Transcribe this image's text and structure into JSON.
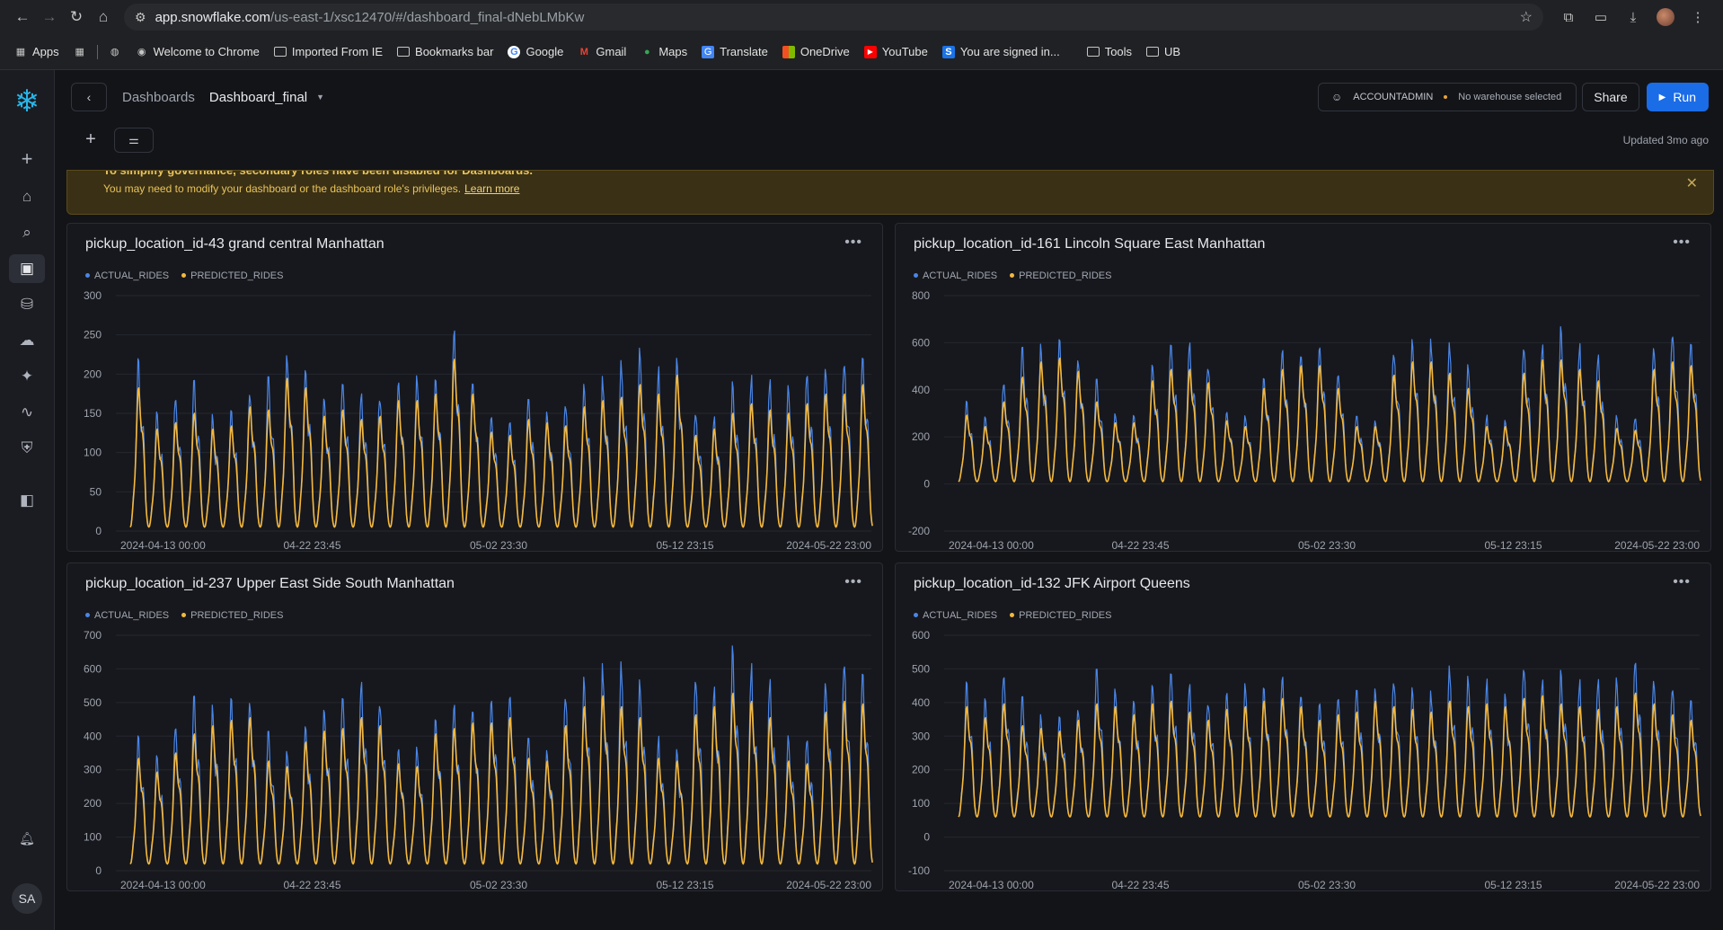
{
  "browser": {
    "url_host": "app.snowflake.com",
    "url_path": "/us-east-1/xsc12470/#/dashboard_final-dNebLMbKw",
    "bookmarks": [
      "Apps",
      "Welcome to Chrome",
      "Imported From IE",
      "Bookmarks bar",
      "Google",
      "Gmail",
      "Maps",
      "Translate",
      "OneDrive",
      "YouTube",
      "You are signed in...",
      "Tools",
      "UB"
    ]
  },
  "header": {
    "breadcrumb": "Dashboards",
    "dashboard_name": "Dashboard_final",
    "role": "ACCOUNTADMIN",
    "warehouse": "No warehouse selected",
    "share_label": "Share",
    "run_label": "Run",
    "updated": "Updated 3mo ago"
  },
  "banner": {
    "title": "To simplify governance, secondary roles have been disabled for Dashboards.",
    "message": "You may need to modify your dashboard or the dashboard role's privileges.",
    "link": "Learn more"
  },
  "user_initials": "SA",
  "legend": {
    "actual": "ACTUAL_RIDES",
    "predicted": "PREDICTED_RIDES"
  },
  "colors": {
    "actual": "#4a86e8",
    "predicted": "#f5b83d",
    "accent": "#1a6ce7"
  },
  "chart_data": [
    {
      "type": "line",
      "title": "pickup_location_id-43 grand central Manhattan",
      "series": [
        {
          "name": "ACTUAL_RIDES"
        },
        {
          "name": "PREDICTED_RIDES"
        }
      ],
      "x_ticks": [
        "2024-04-13 00:00",
        "04-22 23:45",
        "05-02 23:30",
        "05-12 23:15",
        "2024-05-22 23:00"
      ],
      "y_ticks": [
        0,
        50,
        100,
        150,
        200,
        250,
        300
      ],
      "ylim": [
        0,
        300
      ],
      "days": 40,
      "base_min": 5,
      "daily_peaks": [
        225,
        160,
        170,
        185,
        160,
        165,
        195,
        190,
        240,
        225,
        180,
        190,
        175,
        180,
        205,
        205,
        215,
        270,
        215,
        155,
        150,
        175,
        170,
        165,
        195,
        205,
        210,
        230,
        215,
        245,
        150,
        160,
        185,
        200,
        190,
        185,
        200,
        215,
        215,
        230
      ]
    },
    {
      "type": "line",
      "title": "pickup_location_id-161 Lincoln Square East Manhattan",
      "series": [
        {
          "name": "ACTUAL_RIDES"
        },
        {
          "name": "PREDICTED_RIDES"
        }
      ],
      "x_ticks": [
        "2024-04-13 00:00",
        "04-22 23:45",
        "05-02 23:30",
        "05-12 23:15",
        "2024-05-22 23:00"
      ],
      "y_ticks": [
        -200,
        0,
        200,
        400,
        600,
        800
      ],
      "ylim": [
        -200,
        800
      ],
      "days": 40,
      "base_min": 10,
      "daily_peaks": [
        360,
        300,
        430,
        560,
        640,
        660,
        590,
        430,
        320,
        320,
        540,
        600,
        600,
        530,
        330,
        300,
        500,
        600,
        620,
        620,
        500,
        300,
        300,
        570,
        640,
        640,
        580,
        500,
        300,
        300,
        580,
        650,
        650,
        600,
        540,
        290,
        280,
        600,
        640,
        620
      ]
    },
    {
      "type": "line",
      "title": "pickup_location_id-237 Upper East Side South Manhattan",
      "series": [
        {
          "name": "ACTUAL_RIDES"
        },
        {
          "name": "PREDICTED_RIDES"
        }
      ],
      "x_ticks": [
        "2024-04-13 00:00",
        "04-22 23:45",
        "05-02 23:30",
        "05-12 23:15",
        "2024-05-22 23:00"
      ],
      "y_ticks": [
        0,
        100,
        200,
        300,
        400,
        500,
        600,
        700
      ],
      "ylim": [
        0,
        700
      ],
      "days": 40,
      "base_min": 20,
      "daily_peaks": [
        410,
        360,
        430,
        500,
        530,
        550,
        560,
        400,
        380,
        470,
        510,
        520,
        560,
        530,
        390,
        380,
        500,
        520,
        540,
        540,
        560,
        410,
        400,
        530,
        600,
        640,
        600,
        560,
        410,
        400,
        570,
        600,
        650,
        620,
        560,
        400,
        390,
        580,
        620,
        610
      ]
    },
    {
      "type": "line",
      "title": "pickup_location_id-132 JFK Airport Queens",
      "series": [
        {
          "name": "ACTUAL_RIDES"
        },
        {
          "name": "PREDICTED_RIDES"
        }
      ],
      "x_ticks": [
        "2024-04-13 00:00",
        "04-22 23:45",
        "05-02 23:30",
        "05-12 23:15",
        "2024-05-22 23:00"
      ],
      "y_ticks": [
        -100,
        0,
        100,
        200,
        300,
        400,
        500,
        600
      ],
      "ylim": [
        -100,
        600
      ],
      "days": 40,
      "base_min": 60,
      "daily_peaks": [
        470,
        430,
        480,
        400,
        390,
        380,
        420,
        480,
        470,
        440,
        480,
        490,
        450,
        420,
        460,
        470,
        490,
        500,
        470,
        420,
        440,
        450,
        490,
        470,
        460,
        450,
        490,
        470,
        480,
        470,
        500,
        510,
        480,
        470,
        460,
        470,
        520,
        480,
        440,
        420
      ]
    }
  ]
}
